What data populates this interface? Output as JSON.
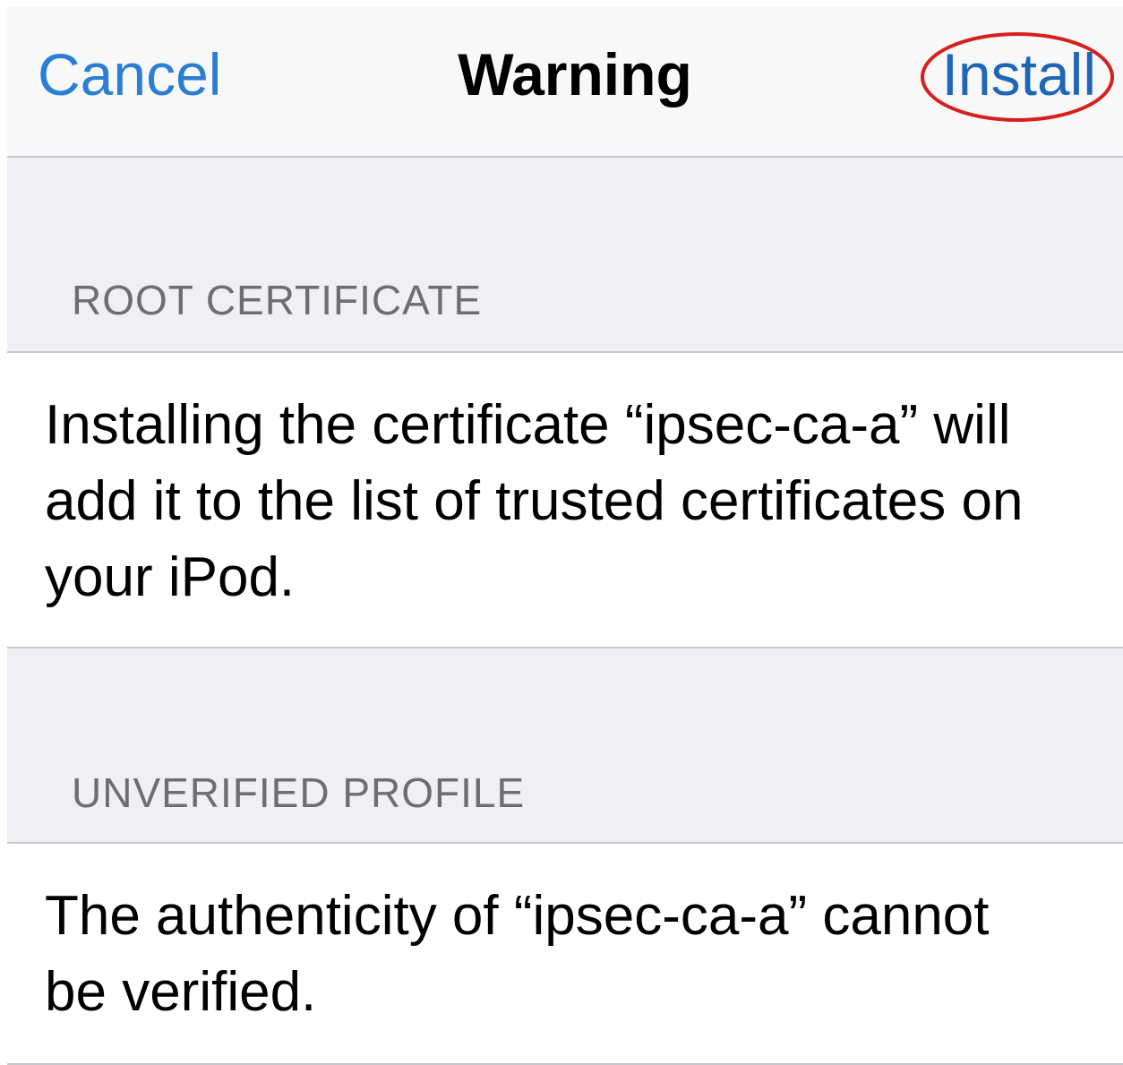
{
  "navbar": {
    "cancel_label": "Cancel",
    "title": "Warning",
    "install_label": "Install",
    "highlight_color": "#d62020"
  },
  "sections": {
    "root_certificate": {
      "header": "ROOT CERTIFICATE",
      "body": "Installing the certificate “ipsec-ca-a” will add it to the list of trusted certificates on your iPod."
    },
    "unverified_profile": {
      "header": "UNVERIFIED PROFILE",
      "body": "The authenticity of “ipsec-ca-a” cannot be verified."
    }
  },
  "colors": {
    "accent": "#2a7fd4",
    "group_background": "#efeff4",
    "header_text": "#6d6d72",
    "separator": "#c8c7cc"
  }
}
